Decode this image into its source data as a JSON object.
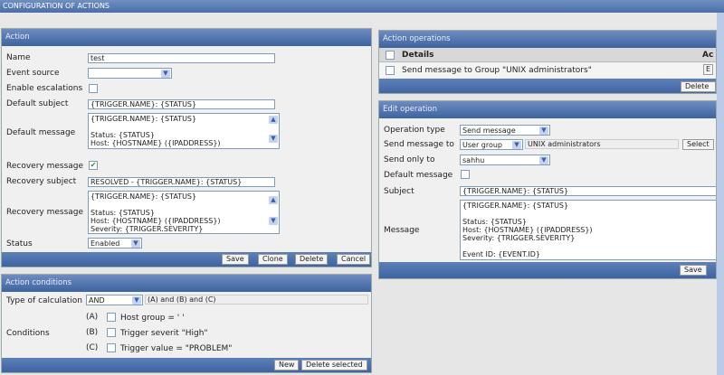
{
  "page_title": "CONFIGURATION OF ACTIONS",
  "action": {
    "title": "Action",
    "name_label": "Name",
    "name_value": "test",
    "event_source_label": "Event source",
    "event_source_value": "",
    "escalations_label": "Enable escalations",
    "escalations_checked": false,
    "default_subject_label": "Default subject",
    "default_subject_value": "{TRIGGER.NAME}: {STATUS}",
    "default_message_label": "Default message",
    "default_message_value": "{TRIGGER.NAME}: {STATUS}\n\nStatus: {STATUS}\nHost: {HOSTNAME} ({IPADDRESS})\nSeverity: {TRIGGER.SEVERITY}",
    "recovery_message_check_label": "Recovery message",
    "recovery_checked": true,
    "recovery_subject_label": "Recovery subject",
    "recovery_subject_value": "RESOLVED - {TRIGGER.NAME}: {STATUS}",
    "recovery_message_label": "Recovery message",
    "recovery_message_value": "{TRIGGER.NAME}: {STATUS}\n\nStatus: {STATUS}\nHost: {HOSTNAME} ({IPADDRESS})\nSeverity: {TRIGGER.SEVERITY}",
    "status_label": "Status",
    "status_value": "Enabled",
    "buttons": {
      "save": "Save",
      "clone": "Clone",
      "delete": "Delete",
      "cancel": "Cancel"
    }
  },
  "conditions": {
    "title": "Action conditions",
    "calc_label": "Type of calculation",
    "calc_value": "AND",
    "calc_formula": "(A) and (B) and (C)",
    "conditions_label": "Conditions",
    "items": [
      {
        "letter": "(A)",
        "text": "Host group = '      '"
      },
      {
        "letter": "(B)",
        "text": "Trigger severit       \"High\""
      },
      {
        "letter": "(C)",
        "text": "Trigger value = \"PROBLEM\""
      }
    ],
    "buttons": {
      "new": "New",
      "delete_selected": "Delete selected"
    }
  },
  "operations": {
    "title": "Action operations",
    "col_details": "Details",
    "col_action": "Ac",
    "rows": [
      {
        "details": "Send message to Group \"UNIX administrators\"",
        "action": "E"
      }
    ],
    "delete_label": "Delete :"
  },
  "edit_operation": {
    "title": "Edit operation",
    "op_type_label": "Operation type",
    "op_type_value": "Send message",
    "send_to_label": "Send message to",
    "send_to_type": "User group",
    "send_to_value": "UNIX administrators",
    "select_label": "Select",
    "send_only_label": "Send only to",
    "send_only_value": "sahhu",
    "default_message_label": "Default message",
    "default_message_checked": false,
    "subject_label": "Subject",
    "subject_value": "{TRIGGER.NAME}: {STATUS}",
    "message_label": "Message",
    "message_value": "{TRIGGER.NAME}: {STATUS}\n\nStatus: {STATUS}\nHost: {HOSTNAME} ({IPADDRESS})\nSeverity: {TRIGGER.SEVERITY}\n\nEvent ID: {EVENT.ID}",
    "save_label": "Save"
  }
}
